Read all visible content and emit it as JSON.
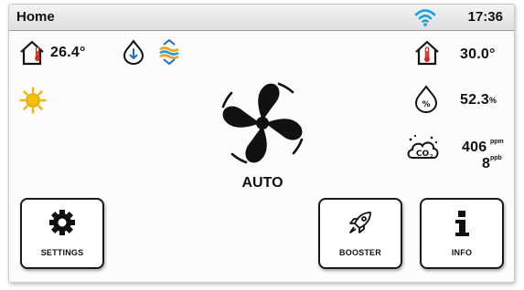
{
  "header": {
    "title": "Home",
    "time": "17:36"
  },
  "indoor": {
    "temperature": "26.4°"
  },
  "outdoor": {
    "temperature": "30.0°"
  },
  "humidity": {
    "value": "52.3",
    "unit": "%"
  },
  "co2": {
    "value_1": "406",
    "unit_1": "ppm",
    "value_2": "8",
    "unit_2": "ppb"
  },
  "fan": {
    "mode": "AUTO"
  },
  "buttons": {
    "settings": "SETTINGS",
    "booster": "BOOSTER",
    "info": "INFO"
  },
  "colors": {
    "wifi": "#1aa0e0",
    "sun": "#f2b705",
    "thermo": "#d42a1f",
    "water_wave": "#f4a11a"
  }
}
